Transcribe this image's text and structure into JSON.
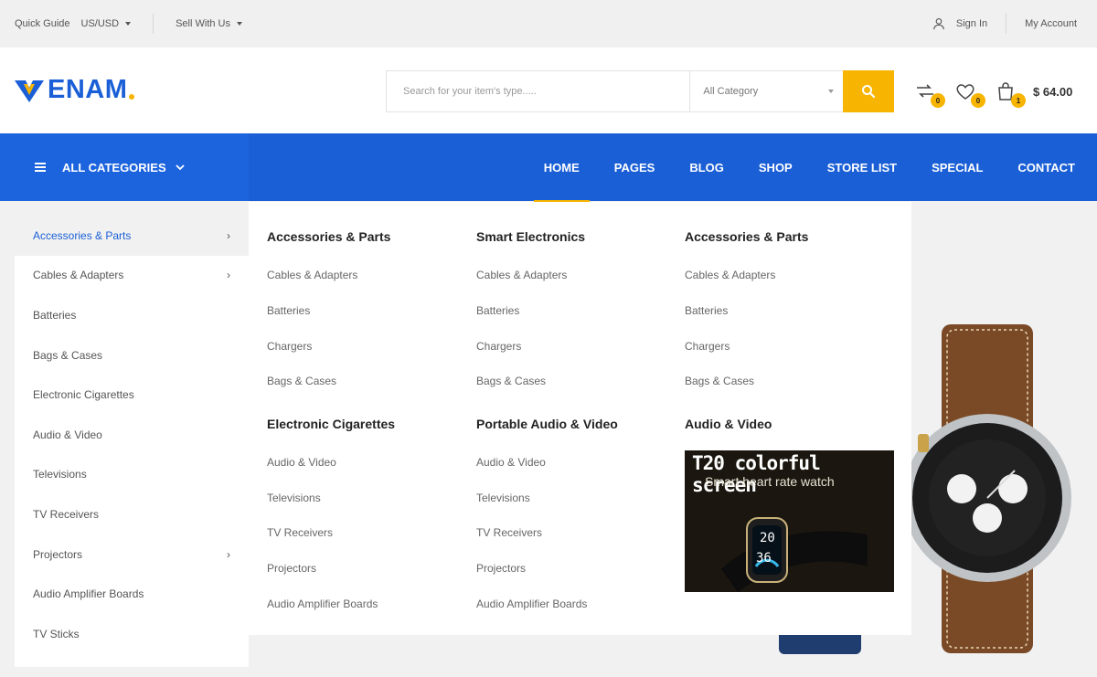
{
  "topbar": {
    "quick_guide": "Quick Guide",
    "currency": "US/USD",
    "sell": "Sell With Us",
    "sign_in": "Sign In",
    "my_account": "My Account"
  },
  "header": {
    "logo": "ENAM",
    "search_placeholder": "Search for your item's type.....",
    "category_select": "All Category",
    "compare_count": "0",
    "wishlist_count": "0",
    "cart_count": "1",
    "cart_total": "$ 64.00",
    "accent_color": "#f7b400",
    "brand_color": "#1a5fd6"
  },
  "nav": {
    "all_categories": "ALL CATEGORIES",
    "links": [
      "HOME",
      "PAGES",
      "BLOG",
      "SHOP",
      "STORE LIST",
      "SPECIAL",
      "CONTACT"
    ],
    "active": "HOME"
  },
  "sidebar": {
    "items": [
      {
        "label": "Accessories & Parts",
        "arrow": true,
        "active": true
      },
      {
        "label": "Cables & Adapters",
        "arrow": true
      },
      {
        "label": "Batteries"
      },
      {
        "label": "Bags & Cases"
      },
      {
        "label": "Electronic Cigarettes"
      },
      {
        "label": "Audio & Video"
      },
      {
        "label": "Televisions"
      },
      {
        "label": "TV Receivers"
      },
      {
        "label": "Projectors",
        "arrow": true
      },
      {
        "label": "Audio Amplifier Boards"
      },
      {
        "label": "TV Sticks"
      }
    ]
  },
  "mega": {
    "col1": {
      "head1": "Accessories & Parts",
      "links1": [
        "Cables & Adapters",
        "Batteries",
        "Chargers",
        "Bags & Cases"
      ],
      "head2": "Electronic Cigarettes",
      "links2": [
        "Audio & Video",
        "Televisions",
        "TV Receivers",
        "Projectors",
        "Audio Amplifier Boards"
      ]
    },
    "col2": {
      "head1": "Smart Electronics",
      "links1": [
        "Cables & Adapters",
        "Batteries",
        "Chargers",
        "Bags & Cases"
      ],
      "head2": "Portable Audio & Video",
      "links2": [
        "Audio & Video",
        "Televisions",
        "TV Receivers",
        "Projectors",
        "Audio Amplifier Boards"
      ]
    },
    "col3": {
      "head1": "Accessories & Parts",
      "links1": [
        "Cables & Adapters",
        "Batteries",
        "Chargers",
        "Bags & Cases"
      ],
      "head2": "Audio & Video",
      "promo_title": "T20 colorful screen",
      "promo_subtitle": "Smart heart rate watch",
      "promo_display_1": "20",
      "promo_display_2": "36"
    }
  }
}
